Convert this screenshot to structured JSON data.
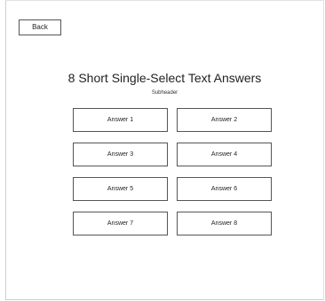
{
  "header": {
    "back_label": "Back"
  },
  "main": {
    "title": "8 Short Single-Select Text Answers",
    "subheader": "Subheader",
    "answers": [
      {
        "label": "Answer 1"
      },
      {
        "label": "Answer 2"
      },
      {
        "label": "Answer 3"
      },
      {
        "label": "Answer 4"
      },
      {
        "label": "Answer 5"
      },
      {
        "label": "Answer 6"
      },
      {
        "label": "Answer 7"
      },
      {
        "label": "Answer 8"
      }
    ]
  }
}
